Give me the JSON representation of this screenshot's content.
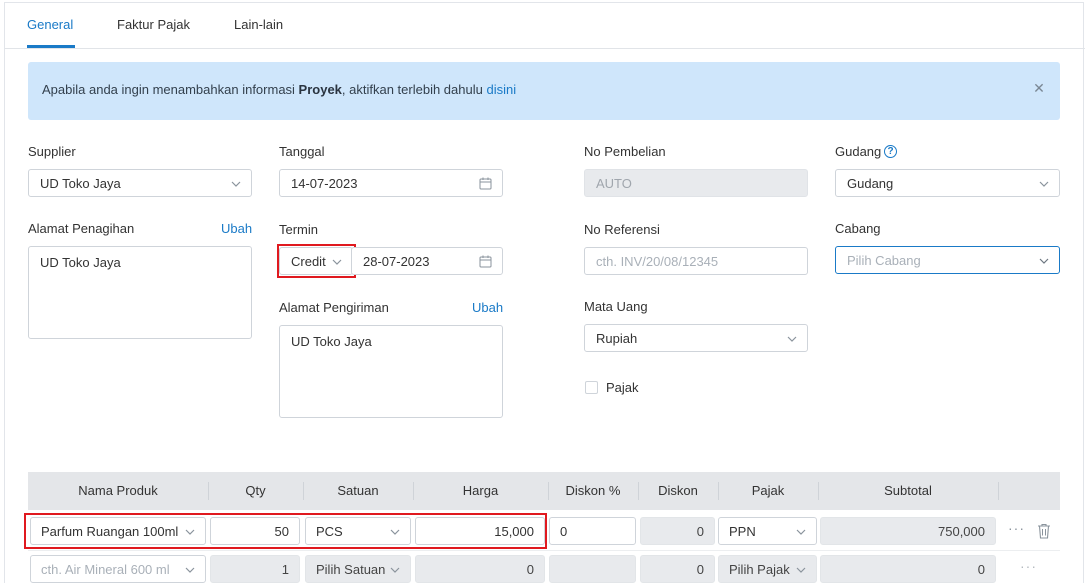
{
  "tabs": [
    {
      "label": "General",
      "active": true
    },
    {
      "label": "Faktur Pajak",
      "active": false
    },
    {
      "label": "Lain-lain",
      "active": false
    }
  ],
  "alert": {
    "text_before": "Apabila anda ingin menambahkan informasi ",
    "bold": "Proyek",
    "text_after": ", aktifkan terlebih dahulu ",
    "link": "disini",
    "close_icon": "close-icon"
  },
  "form": {
    "supplier": {
      "label": "Supplier",
      "value": "UD Toko Jaya"
    },
    "tanggal": {
      "label": "Tanggal",
      "value": "14-07-2023"
    },
    "no_pembelian": {
      "label": "No Pembelian",
      "value": "AUTO"
    },
    "gudang": {
      "label": "Gudang",
      "value": "Gudang",
      "help": "?"
    },
    "alamat_penagihan": {
      "label": "Alamat Penagihan",
      "action": "Ubah",
      "value": "UD Toko Jaya"
    },
    "termin": {
      "label": "Termin",
      "type": "Credit",
      "date": "28-07-2023"
    },
    "no_referensi": {
      "label": "No Referensi",
      "placeholder": "cth. INV/20/08/12345"
    },
    "cabang": {
      "label": "Cabang",
      "placeholder": "Pilih Cabang"
    },
    "alamat_pengiriman": {
      "label": "Alamat Pengiriman",
      "action": "Ubah",
      "value": "UD Toko Jaya"
    },
    "mata_uang": {
      "label": "Mata Uang",
      "value": "Rupiah"
    },
    "pajak": {
      "label": "Pajak",
      "checked": false
    }
  },
  "table": {
    "headers": [
      "Nama Produk",
      "Qty",
      "Satuan",
      "Harga",
      "Diskon %",
      "Diskon",
      "Pajak",
      "Subtotal"
    ],
    "rows": [
      {
        "produk": "Parfum Ruangan 100ml",
        "qty": "50",
        "satuan": "PCS",
        "harga": "15,000",
        "diskon_pct": "0",
        "diskon": "0",
        "pajak": "PPN",
        "subtotal": "750,000"
      },
      {
        "produk": "cth. Air Mineral 600 ml",
        "qty": "1",
        "satuan": "Pilih Satuan",
        "harga": "0",
        "diskon_pct": "",
        "diskon": "0",
        "pajak": "Pilih Pajak",
        "subtotal": "0"
      }
    ],
    "more_label": "···"
  },
  "colors": {
    "accent": "#1a7ac7",
    "alert_bg": "#cfe6fb",
    "highlight": "#e0191f"
  }
}
